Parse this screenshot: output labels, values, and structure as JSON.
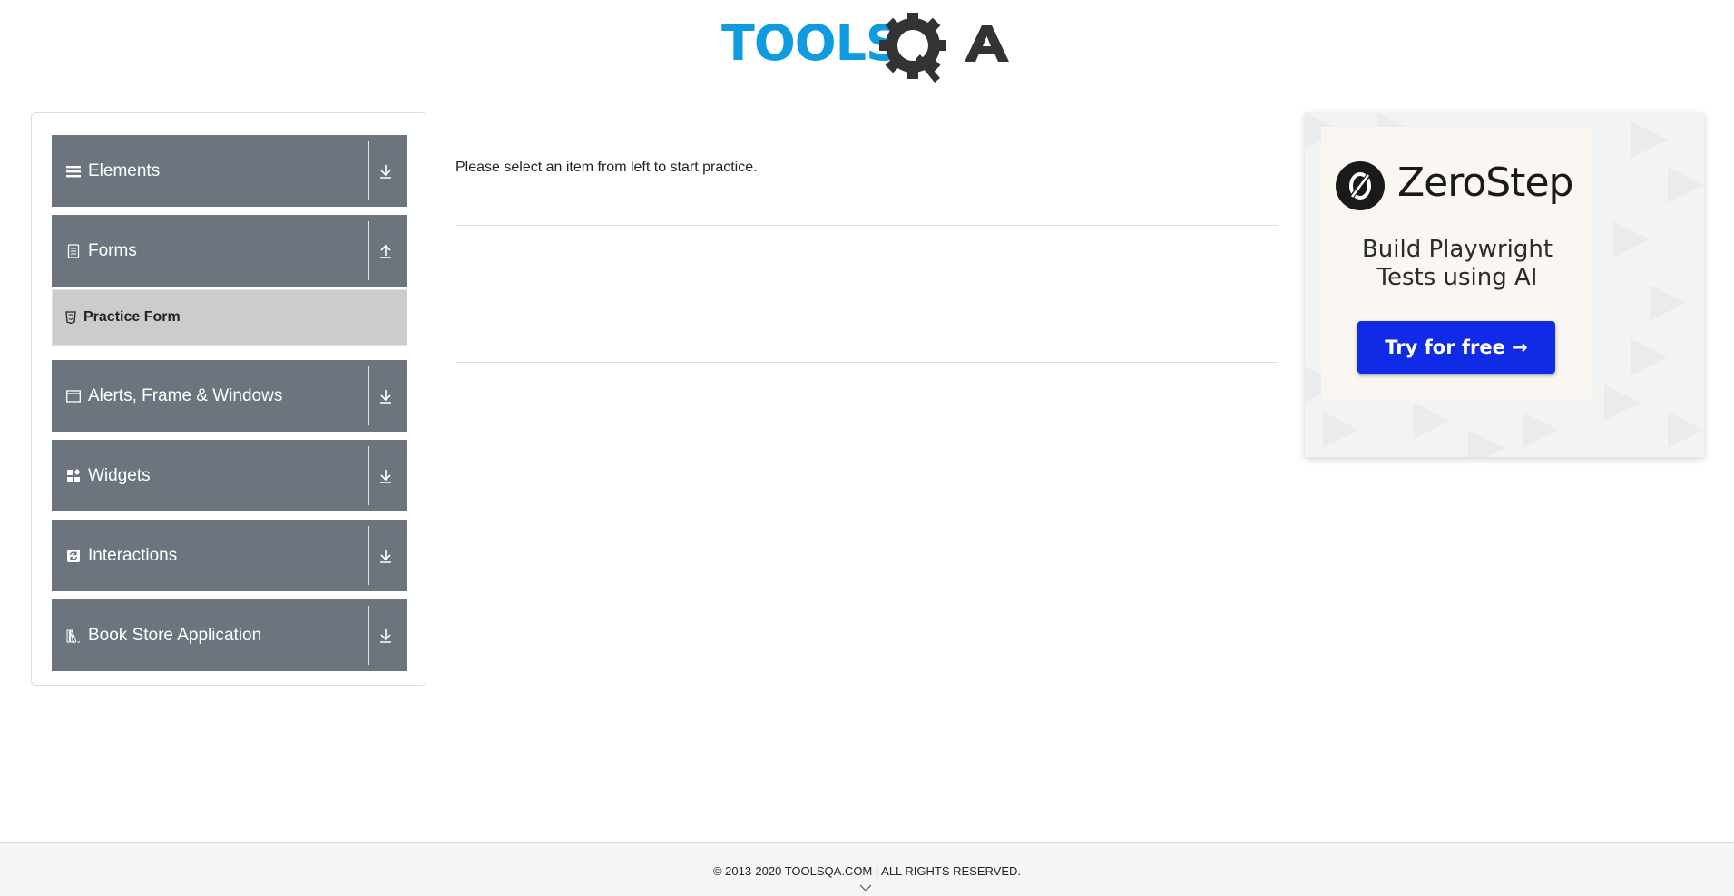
{
  "header": {
    "logo_text_tools": "TOOLS",
    "logo_text_qa": "QA"
  },
  "sidebar": {
    "groups": [
      {
        "label": "Elements",
        "icon": "hamburger-icon",
        "arrow": "download-arrow-icon"
      },
      {
        "label": "Forms",
        "icon": "form-document-icon",
        "arrow": "upload-arrow-icon",
        "expanded": true,
        "items": [
          {
            "label": "Practice Form",
            "icon": "html5-icon",
            "active": true
          }
        ]
      },
      {
        "label": "Alerts, Frame & Windows",
        "icon": "window-icon",
        "arrow": "download-arrow-icon"
      },
      {
        "label": "Widgets",
        "icon": "widgets-icon",
        "arrow": "download-arrow-icon"
      },
      {
        "label": "Interactions",
        "icon": "interactions-icon",
        "arrow": "download-arrow-icon"
      },
      {
        "label": "Book Store Application",
        "icon": "books-icon",
        "arrow": "download-arrow-icon"
      }
    ]
  },
  "main": {
    "instruction": "Please select an item from left to start practice."
  },
  "ad": {
    "brand": "ZeroStep",
    "headline_line1": "Build Playwright",
    "headline_line2": "Tests using AI",
    "cta_label": "Try for free →",
    "cta_color": "#0f2be6"
  },
  "footer": {
    "copyright": "© 2013-2020 TOOLSQA.COM | ALL RIGHTS RESERVED."
  },
  "colors": {
    "group_bg": "#6c757d",
    "subitem_bg": "#cccccc",
    "logo_blue": "#0e9be0",
    "logo_dark": "#333333"
  }
}
